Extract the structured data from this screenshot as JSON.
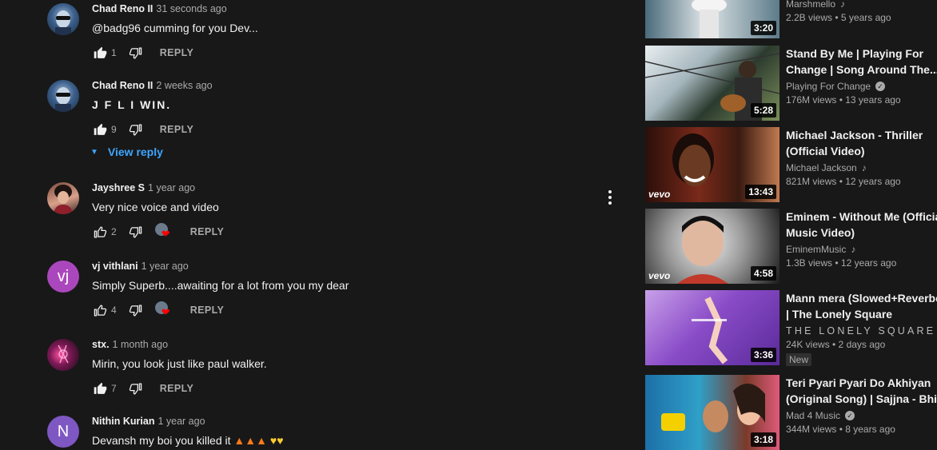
{
  "comments": [
    {
      "author": "Chad Reno II",
      "time": "31 seconds ago",
      "text": "@badg96 cumming for you Dev...",
      "likes": "1",
      "reply": "REPLY"
    },
    {
      "author": "Chad Reno II",
      "time": "2 weeks ago",
      "text": "J F L I WIN.",
      "likes": "9",
      "reply": "REPLY",
      "view_reply": "View reply"
    },
    {
      "author": "Jayshree S",
      "time": "1 year ago",
      "text": "Very nice voice and video",
      "likes": "2",
      "reply": "REPLY"
    },
    {
      "author": "vj vithlani",
      "time": "1 year ago",
      "text": "Simply Superb....awaiting for a lot from you my dear",
      "likes": "4",
      "reply": "REPLY",
      "avatar_letter": "vj"
    },
    {
      "author": "stx.",
      "time": "1 month ago",
      "text": "Mirin, you look just like paul walker.",
      "likes": "7",
      "reply": "REPLY"
    },
    {
      "author": "Nithin Kurian",
      "time": "1 year ago",
      "text": "Devansh my boi you killed it",
      "likes": "",
      "reply": "REPLY",
      "avatar_letter": "N"
    }
  ],
  "sidebar": [
    {
      "title_1": "",
      "title_2": "",
      "channel": "Marshmello",
      "stats": "2.2B views • 5 years ago",
      "duration": "3:20"
    },
    {
      "title_1": "Stand By Me | Playing For",
      "title_2": "Change | Song Around The...",
      "channel": "Playing For Change",
      "stats": "176M views • 13 years ago",
      "duration": "5:28"
    },
    {
      "title_1": "Michael Jackson - Thriller",
      "title_2": "(Official Video)",
      "channel": "Michael Jackson",
      "stats": "821M views • 12 years ago",
      "duration": "13:43",
      "vevo": "vevo"
    },
    {
      "title_1": "Eminem - Without Me (Official",
      "title_2": "Music Video)",
      "channel": "EminemMusic",
      "stats": "1.3B views • 12 years ago",
      "duration": "4:58",
      "vevo": "vevo"
    },
    {
      "title_1": "Mann mera (Slowed+Reverbed)",
      "title_2": "| The Lonely Square",
      "channel": "THE LONELY SQUARE",
      "stats": "24K views • 2 days ago",
      "duration": "3:36",
      "badge": "New"
    },
    {
      "title_1": "Teri Pyari Pyari Do Akhiyan",
      "title_2": "(Original Song) | Sajjna - Bhinda",
      "channel": "Mad 4 Music",
      "stats": "344M views • 8 years ago",
      "duration": "3:18"
    }
  ],
  "colors": {
    "background": "#181818",
    "link": "#3ea6ff",
    "heart": "#ff0000"
  }
}
